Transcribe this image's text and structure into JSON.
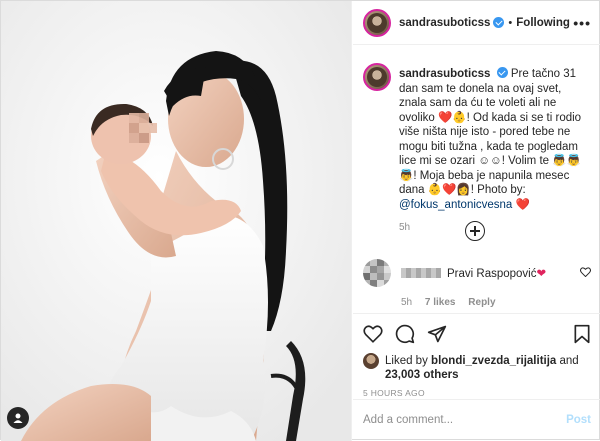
{
  "header": {
    "username": "sandrasuboticss",
    "separator": "•",
    "follow_status": "Following",
    "more_label": "•••"
  },
  "caption": {
    "username": "sandrasuboticss",
    "text_before_emoji": "Pre tačno 31 dan sam te donela na ovaj svet, znala sam da ću te voleti ali ne ovoliko",
    "emoji_1": "❤️👶",
    "text_2": "! Od kada si se ti rodio više ništa nije isto - pored tebe ne mogu biti tužna , kada te pogledam lice mi se ozari",
    "emoji_2": "☺☺",
    "text_3": "! Volim te",
    "emoji_3": "👼👼👼",
    "text_4": "! Moja beba je napunila mesec dana",
    "emoji_4": "👶❤️👩",
    "text_5": "! Photo by:",
    "mention": "@fokus_antonicvesna",
    "emoji_5": "❤️",
    "time_ago": "5h"
  },
  "comment": {
    "text": "Pravi Raspopović",
    "heart": "❤",
    "time": "5h",
    "likes": "7 likes",
    "reply": "Reply"
  },
  "likes": {
    "prefix": "Liked by",
    "user": "blondi_zvezda_rijalitija",
    "and": "and",
    "others": "23,003 others"
  },
  "post_time": "5 HOURS AGO",
  "add_comment": {
    "placeholder": "Add a comment...",
    "post_label": "Post"
  },
  "icons": {
    "like": "heart-outline-icon",
    "comment": "comment-bubble-icon",
    "share": "paper-plane-icon",
    "save": "bookmark-icon",
    "tag_user": "user-tag-icon"
  },
  "colors": {
    "verified": "#3897f0",
    "link": "#00376b",
    "heart": "#e0245e",
    "post_button": "#b2dffc",
    "muted": "#8e8e8e"
  }
}
